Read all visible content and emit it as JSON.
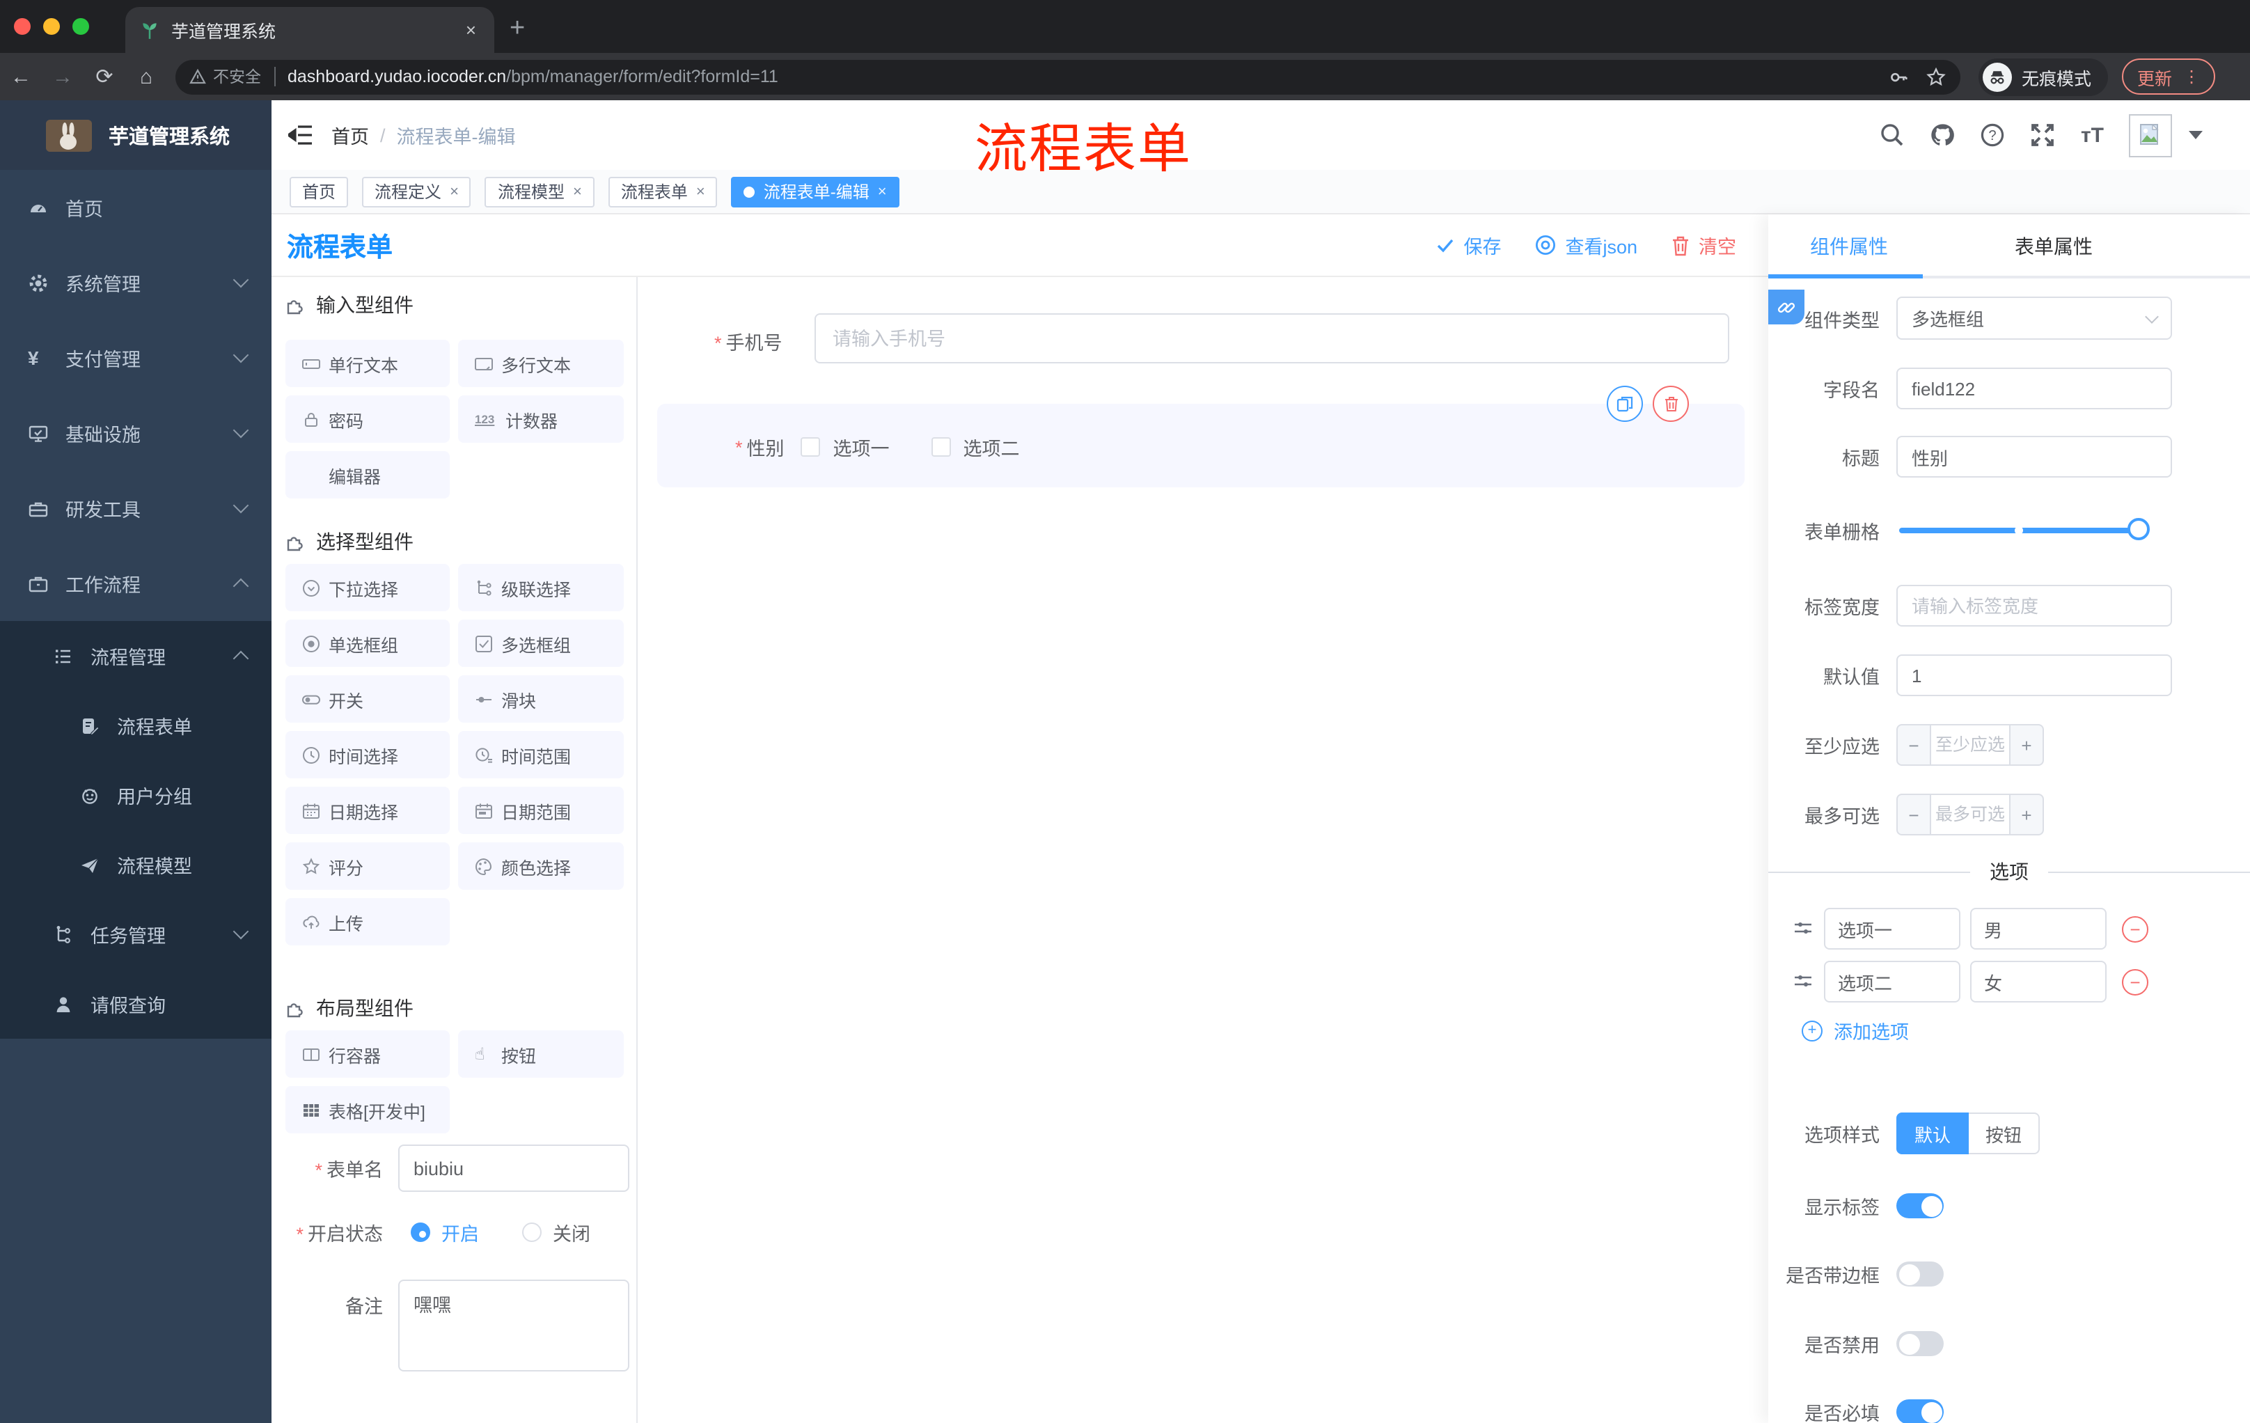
{
  "browser": {
    "tab_title": "芋道管理系统",
    "close_tab": "×",
    "new_tab": "+",
    "url_warning": "不安全",
    "url_domain": "dashboard.yudao.iocoder.cn",
    "url_path": "/bpm/manager/form/edit?formId=11",
    "incognito_label": "无痕模式",
    "update_label": "更新",
    "menu_dots": "⋮"
  },
  "annotation": {
    "text": "流程表单",
    "color": "#ff2600"
  },
  "sidebar": {
    "logo_title": "芋道管理系统",
    "items": [
      {
        "label": "首页"
      },
      {
        "label": "系统管理"
      },
      {
        "label": "支付管理"
      },
      {
        "label": "基础设施"
      },
      {
        "label": "研发工具"
      },
      {
        "label": "工作流程"
      },
      {
        "label": "流程管理"
      },
      {
        "label": "流程表单"
      },
      {
        "label": "用户分组"
      },
      {
        "label": "流程模型"
      },
      {
        "label": "任务管理"
      },
      {
        "label": "请假查询"
      }
    ]
  },
  "header": {
    "breadcrumb": [
      "首页",
      "流程表单-编辑"
    ],
    "separator": "/"
  },
  "tags": [
    {
      "label": "首页"
    },
    {
      "label": "流程定义"
    },
    {
      "label": "流程模型"
    },
    {
      "label": "流程表单"
    },
    {
      "label": "流程表单-编辑"
    }
  ],
  "designer": {
    "title": "流程表单",
    "actions": {
      "save": "保存",
      "view_json": "查看json",
      "clear": "清空"
    },
    "palette": {
      "groups": [
        {
          "title": "输入型组件",
          "items": [
            {
              "label": "单行文本"
            },
            {
              "label": "多行文本"
            },
            {
              "label": "密码"
            },
            {
              "label": "计数器"
            },
            {
              "label": "编辑器"
            }
          ]
        },
        {
          "title": "选择型组件",
          "items": [
            {
              "label": "下拉选择"
            },
            {
              "label": "级联选择"
            },
            {
              "label": "单选框组"
            },
            {
              "label": "多选框组"
            },
            {
              "label": "开关"
            },
            {
              "label": "滑块"
            },
            {
              "label": "时间选择"
            },
            {
              "label": "时间范围"
            },
            {
              "label": "日期选择"
            },
            {
              "label": "日期范围"
            },
            {
              "label": "评分"
            },
            {
              "label": "颜色选择"
            },
            {
              "label": "上传"
            }
          ]
        },
        {
          "title": "布局型组件",
          "items": [
            {
              "label": "行容器"
            },
            {
              "label": "按钮"
            },
            {
              "label": "表格[开发中]"
            }
          ]
        }
      ]
    },
    "meta_form": {
      "form_name_label": "表单名",
      "form_name_value": "biubiu",
      "status_label": "开启状态",
      "status_on": "开启",
      "status_off": "关闭",
      "status_selected": "开启",
      "remark_label": "备注",
      "remark_value": "嘿嘿"
    },
    "canvas": {
      "phone_field": {
        "label": "手机号",
        "placeholder": "请输入手机号",
        "required": "*"
      },
      "gender_field": {
        "label": "性别",
        "required": "*",
        "options": [
          {
            "label": "选项一"
          },
          {
            "label": "选项二"
          }
        ]
      }
    }
  },
  "properties": {
    "tabs": [
      {
        "label": "组件属性"
      },
      {
        "label": "表单属性"
      }
    ],
    "active_tab": "组件属性",
    "rows": {
      "component_type": {
        "label": "组件类型",
        "value": "多选框组"
      },
      "field_name": {
        "label": "字段名",
        "value": "field122"
      },
      "title": {
        "label": "标题",
        "value": "性别"
      },
      "grid": {
        "label": "表单栅格"
      },
      "label_width": {
        "label": "标签宽度",
        "placeholder": "请输入标签宽度"
      },
      "default_value": {
        "label": "默认值",
        "value": "1"
      },
      "min_select": {
        "label": "至少应选",
        "placeholder": "至少应选"
      },
      "max_select": {
        "label": "最多可选",
        "placeholder": "最多可选"
      }
    },
    "options_section": {
      "title": "选项",
      "options": [
        {
          "label": "选项一",
          "value": "男"
        },
        {
          "label": "选项二",
          "value": "女"
        }
      ],
      "add_label": "添加选项"
    },
    "style_rows": {
      "option_style": {
        "label": "选项样式",
        "opt_default": "默认",
        "opt_button": "按钮",
        "selected": "默认"
      },
      "show_label": {
        "label": "显示标签",
        "on": true
      },
      "border": {
        "label": "是否带边框",
        "on": false
      },
      "disabled": {
        "label": "是否禁用",
        "on": false
      },
      "required": {
        "label": "是否必填",
        "on": true
      }
    },
    "colors": {
      "accent": "#409eff",
      "danger": "#f56c6c",
      "sidebar": "#304156",
      "submenu": "#1f2d3d"
    }
  }
}
